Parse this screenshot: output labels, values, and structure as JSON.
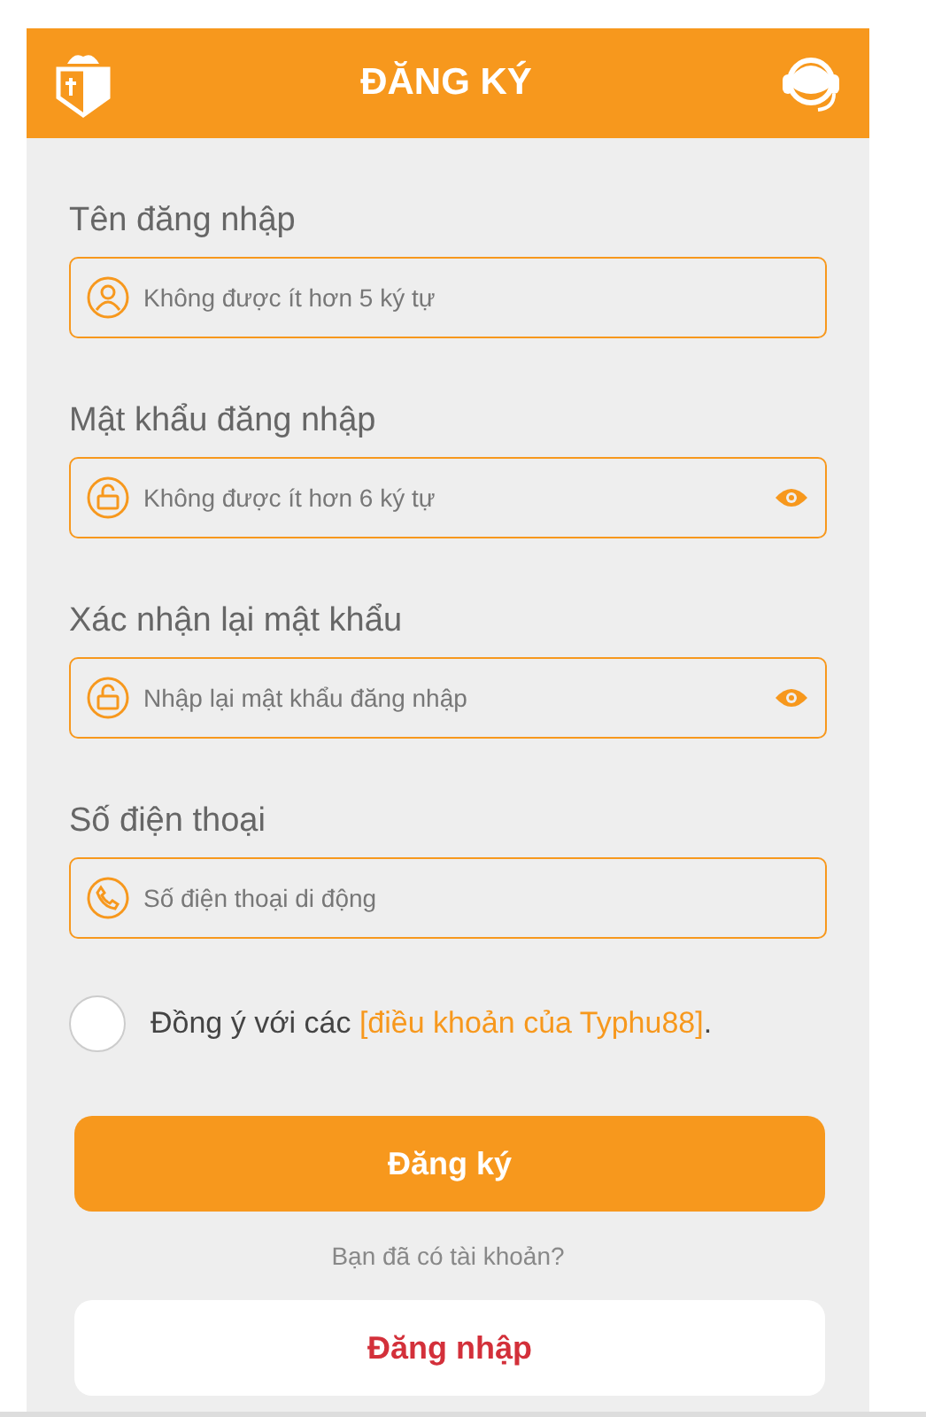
{
  "header": {
    "title": "ĐĂNG KÝ"
  },
  "fields": [
    {
      "kind": "user",
      "label": "Tên đăng nhập",
      "placeholder": "Không được ít hơn 5 ký tự"
    },
    {
      "kind": "password",
      "label": "Mật khẩu đăng nhập",
      "placeholder": "Không được ít hơn 6 ký tự"
    },
    {
      "kind": "password",
      "label": "Xác nhận lại mật khẩu",
      "placeholder": "Nhập lại mật khẩu đăng nhập"
    },
    {
      "kind": "phone",
      "label": "Số điện thoại",
      "placeholder": "Số điện thoại di động"
    }
  ],
  "agree": {
    "checked": false,
    "text": "Đồng ý với các",
    "link": "[điều khoản của Typhu88]",
    "end": "."
  },
  "submit": "Đăng ký",
  "question": "Bạn đã có tài khoản?",
  "login": "Đăng nhập"
}
